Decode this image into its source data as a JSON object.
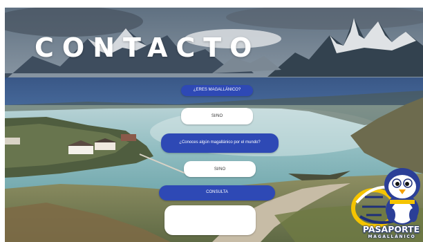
{
  "header": {
    "title": "CONTACTO"
  },
  "form": {
    "question_1": "¿ERES MAGALLÁNICO?",
    "answer_1_value": "SI/NO",
    "question_2": "¿Conoces algún magallánico por el mundo?",
    "answer_2_value": "SI/NO",
    "consulta_label": "CONSULTA",
    "consulta_value": ""
  },
  "brand": {
    "name": "PASAPORTE",
    "tagline": "MAGALLÁNICO"
  },
  "colors": {
    "accent": "#2e49b5",
    "field_background": "#ffffff",
    "brand_blue": "#1e2f7a",
    "brand_yellow": "#f5c400"
  },
  "icons": [
    "penguin-mascot-icon",
    "globe-arc-icon"
  ]
}
